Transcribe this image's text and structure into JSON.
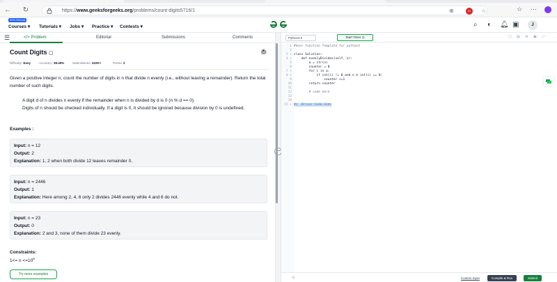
{
  "browser": {
    "url_prefix": "https://",
    "url_domain": "www.geeksforgeeks.org",
    "url_path": "/problems/count-digits5716/1",
    "notification_count": "11"
  },
  "header": {
    "promo_badge": "90% Refund",
    "nav": [
      "Courses",
      "Tutorials",
      "Jobs",
      "Practice",
      "Contests"
    ],
    "avatar_initial": "J"
  },
  "tabs": {
    "problem": "</> Problem",
    "editorial": "Editorial",
    "submissions": "Submissions",
    "comments": "Comments"
  },
  "problem": {
    "title": "Count Digits",
    "difficulty_label": "Difficulty:",
    "difficulty": "Easy",
    "accuracy_label": "Accuracy:",
    "accuracy": "38.45%",
    "submissions_label": "Submissions:",
    "submissions": "422K+",
    "points_label": "Points:",
    "points": "2",
    "description_1": "Given a positive integer n, count the number of digits in n that divide n evenly (i.e., without leaving a remainder). Return the total number of such digits.",
    "note_1": "A digit d of n divides n evenly if the remainder when n is divided by d is 0 (n % d == 0).",
    "note_2": "Digits of n should be checked individually. If a digit is 0, it should be ignored because division by 0 is undefined.",
    "examples_heading": "Examples :",
    "examples": [
      {
        "input_label": "Input:",
        "input": "n = 12",
        "output_label": "Output:",
        "output": "2",
        "explanation_label": "Explanation:",
        "explanation": "1, 2 when both divide 12 leaves remainder 0."
      },
      {
        "input_label": "Input:",
        "input": "n = 2446",
        "output_label": "Output:",
        "output": "1",
        "explanation_label": "Explanation:",
        "explanation": "Here among 2, 4, 6 only 2 divides 2446 evenly while 4 and 6 do not."
      },
      {
        "input_label": "Input:",
        "input": "n = 23",
        "output_label": "Output:",
        "output": "0",
        "explanation_label": "Explanation:",
        "explanation": "2 and 3, none of them divide 23 evenly."
      }
    ],
    "constraints_heading": "Constraints:",
    "constraint": "1<= n <=10",
    "constraint_exp": "5",
    "try_more": "Try more examples"
  },
  "editor": {
    "language": "Python3",
    "start_timer": "Start Timer",
    "lines": [
      {
        "n": "1",
        "text": "#User function Template for python3"
      },
      {
        "n": "2",
        "text": ""
      },
      {
        "n": "3 ▾",
        "text": "class Solution:"
      },
      {
        "n": "4 ▾",
        "text": "    def evenlyDivides(self, n):"
      },
      {
        "n": "5",
        "text": "        a = str(n)"
      },
      {
        "n": "6",
        "text": "        counter = 0"
      },
      {
        "n": "7 ▾",
        "text": "        for i in a:"
      },
      {
        "n": "8 ▾",
        "text": "            if int(i) != 0 and n % int(i) == 0:"
      },
      {
        "n": "9",
        "text": "                counter +=1"
      },
      {
        "n": "10",
        "text": "        return counter"
      },
      {
        "n": "11",
        "text": ""
      },
      {
        "n": "12",
        "text": "        # code here"
      },
      {
        "n": "13",
        "text": ""
      },
      {
        "n": "14",
        "text": ""
      },
      {
        "n": "15 ▸",
        "text": "#{  Driver Code Ends"
      }
    ],
    "custom_input": "Custom Input",
    "compile_run": "Compile & Run",
    "submit": "Submit"
  },
  "colors": {
    "accent_green": "#15803d",
    "brand_blue": "#2563eb",
    "compile_bg": "#374151"
  },
  "icons": [
    "back-icon",
    "reload-icon",
    "lock-icon",
    "search-icon",
    "star-icon",
    "menu-icon",
    "theme-icon",
    "bell-icon",
    "bug-icon",
    "sun-icon"
  ]
}
